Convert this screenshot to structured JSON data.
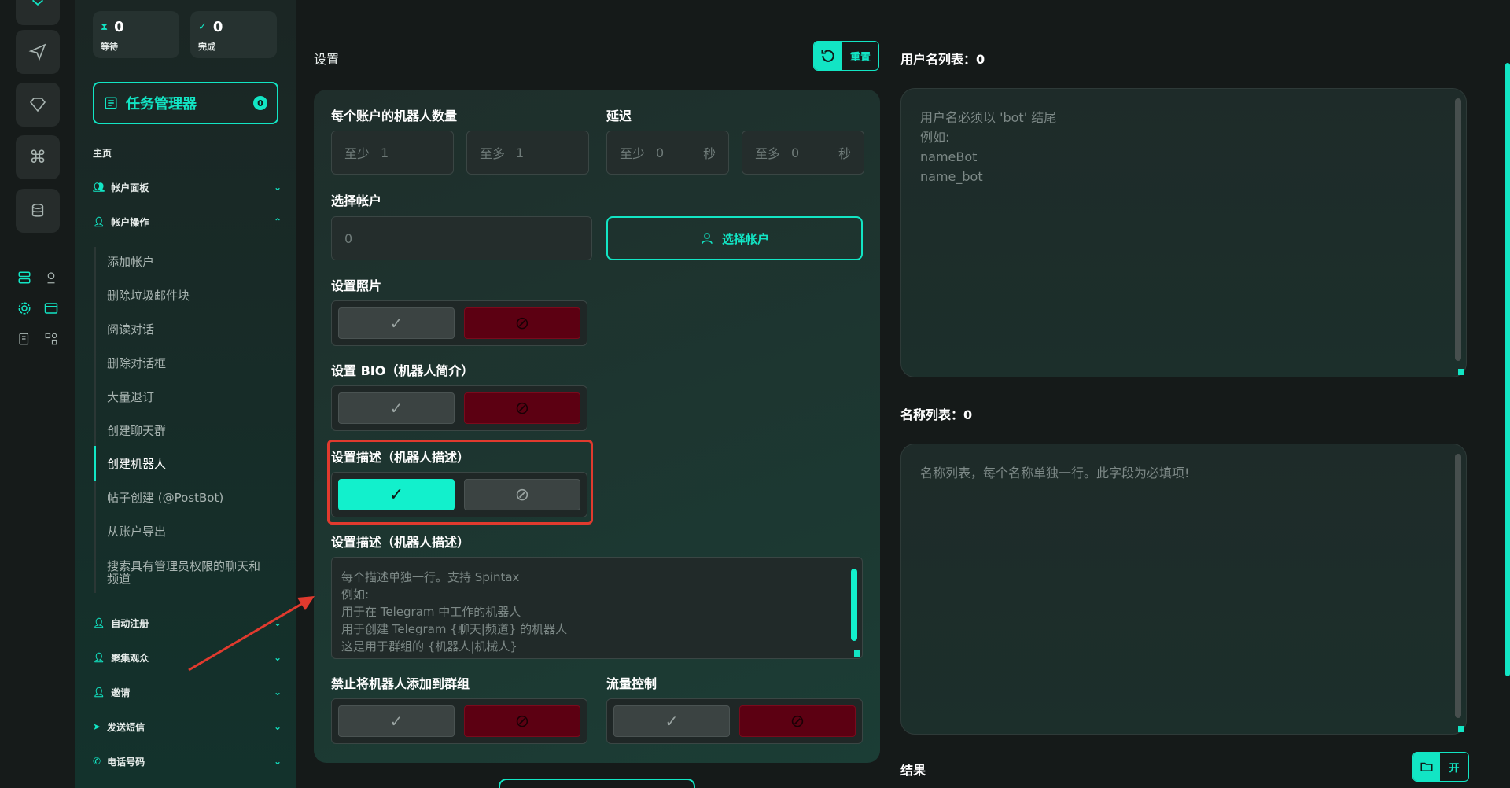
{
  "stats": {
    "waiting_value": "0",
    "waiting_label": "等待",
    "done_value": "0",
    "done_label": "完成"
  },
  "task_manager": {
    "label": "任务管理器",
    "badge": "0"
  },
  "sidebar": {
    "section_home": "主页",
    "account_panel": "帐户面板",
    "account_ops": "帐户操作",
    "sub_items": [
      "添加帐户",
      "删除垃圾邮件块",
      "阅读对话",
      "删除对话框",
      "大量退订",
      "创建聊天群",
      "创建机器人",
      "帖子创建 (@PostBot)",
      "从账户导出",
      "搜索具有管理员权限的聊天和频道"
    ],
    "auto_register": "自动注册",
    "gather_audience": "聚集观众",
    "invite": "邀请",
    "send_sms": "发送短信",
    "phone_number": "电话号码"
  },
  "main": {
    "title": "设置",
    "reset_label": "重置",
    "bots_per_account": "每个账户的机器人数量",
    "delay": "延迟",
    "min_label": "至少",
    "max_label": "至多",
    "bots_min": "1",
    "bots_max": "1",
    "delay_min": "0",
    "delay_max": "0",
    "sec_unit": "秒",
    "select_account_label": "选择帐户",
    "select_account_value": "0",
    "select_account_button": "选择帐户",
    "set_photo": "设置照片",
    "set_bio": "设置 BIO（机器人简介）",
    "set_desc": "设置描述（机器人描述）",
    "set_desc_2": "设置描述（机器人描述）",
    "desc_placeholder": [
      "每个描述单独一行。支持 Spintax",
      "例如:",
      "用于在 Telegram 中工作的机器人",
      "用于创建 Telegram {聊天|频道} 的机器人",
      "这是用于群组的 {机器人|机械人}"
    ],
    "forbid_groups": "禁止将机器人添加到群组",
    "flow_control": "流量控制"
  },
  "right": {
    "usernames_title": "用户名列表：0",
    "usernames_placeholder": [
      "用户名必须以 'bot' 结尾",
      "例如:",
      "nameBot",
      "name_bot"
    ],
    "names_title": "名称列表：0",
    "names_placeholder": "名称列表，每个名称单独一行。此字段为必填项!",
    "result_title": "结果",
    "open_label": "开"
  },
  "colors": {
    "accent": "#12e5c4",
    "danger": "#5c0012",
    "annotation": "#e03a2e"
  }
}
